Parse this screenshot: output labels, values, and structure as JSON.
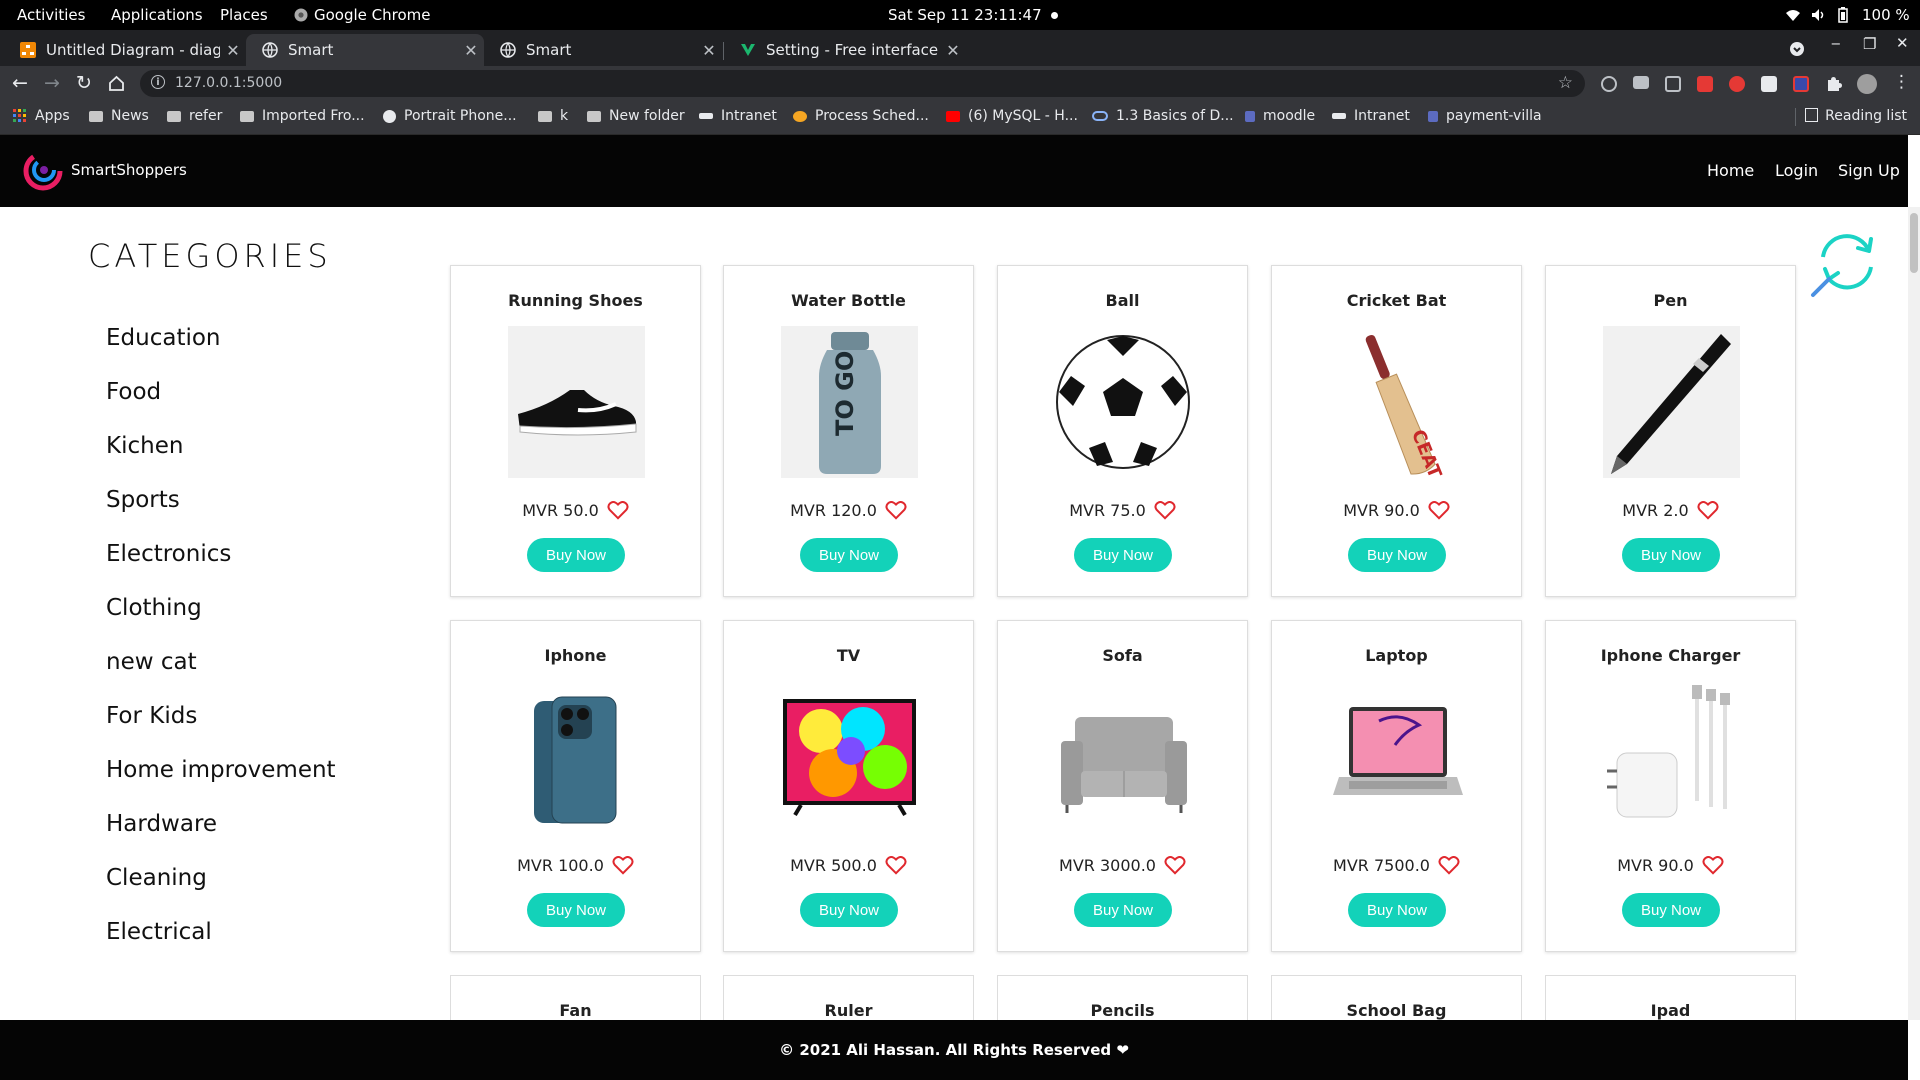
{
  "system_bar": {
    "activities": "Activities",
    "applications": "Applications",
    "places": "Places",
    "app_name": "Google Chrome",
    "clock": "Sat Sep 11  23:11:47",
    "battery": "100 %"
  },
  "browser": {
    "tabs": [
      {
        "title": "Untitled Diagram - diagrams.net"
      },
      {
        "title": "Smart"
      },
      {
        "title": "Smart"
      },
      {
        "title": "Setting - Free interface icons"
      }
    ],
    "url": "127.0.0.1:5000",
    "bookmarks": [
      {
        "label": "Apps",
        "icon": "apps-grid-icon"
      },
      {
        "label": "News",
        "icon": "folder-icon"
      },
      {
        "label": "refer",
        "icon": "folder-icon"
      },
      {
        "label": "Imported Fro...",
        "icon": "folder-icon"
      },
      {
        "label": "Portrait Phone...",
        "icon": "globe-icon"
      },
      {
        "label": "k",
        "icon": "folder-icon"
      },
      {
        "label": "New folder",
        "icon": "folder-icon"
      },
      {
        "label": "Intranet",
        "icon": "intranet-icon"
      },
      {
        "label": "Process Sched...",
        "icon": "process-icon"
      },
      {
        "label": "(6) MySQL - H...",
        "icon": "youtube-icon"
      },
      {
        "label": "1.3 Basics of D...",
        "icon": "link-icon"
      },
      {
        "label": "moodle",
        "icon": "moodle-icon"
      },
      {
        "label": "Intranet",
        "icon": "intranet-icon"
      },
      {
        "label": "payment-villa",
        "icon": "moodle-icon"
      }
    ],
    "reading_list": "Reading list"
  },
  "site": {
    "brand": "SmartShoppers",
    "nav": {
      "home": "Home",
      "login": "Login",
      "signup": "Sign Up"
    },
    "categories_title": "CATEGORIES",
    "categories": [
      "Education",
      "Food",
      "Kichen",
      "Sports",
      "Electronics",
      "Clothing",
      "new cat",
      "For Kids",
      "Home improvement",
      "Hardware",
      "Cleaning",
      "Electrical"
    ],
    "buy_label": "Buy Now",
    "products": [
      {
        "name": "Running Shoes",
        "price": "MVR 50.0",
        "icon": "shoe-image"
      },
      {
        "name": "Water Bottle",
        "price": "MVR 120.0",
        "icon": "bottle-image"
      },
      {
        "name": "Ball",
        "price": "MVR 75.0",
        "icon": "ball-image"
      },
      {
        "name": "Cricket Bat",
        "price": "MVR 90.0",
        "icon": "bat-image"
      },
      {
        "name": "Pen",
        "price": "MVR 2.0",
        "icon": "pen-image"
      },
      {
        "name": "Iphone",
        "price": "MVR 100.0",
        "icon": "phone-image"
      },
      {
        "name": "TV",
        "price": "MVR 500.0",
        "icon": "tv-image"
      },
      {
        "name": "Sofa",
        "price": "MVR 3000.0",
        "icon": "sofa-image"
      },
      {
        "name": "Laptop",
        "price": "MVR 7500.0",
        "icon": "laptop-image"
      },
      {
        "name": "Iphone Charger",
        "price": "MVR 90.0",
        "icon": "charger-image"
      }
    ],
    "partial_products": [
      "Fan",
      "Ruler",
      "Pencils",
      "School Bag",
      "Ipad"
    ],
    "footer": "© 2021 Ali Hassan. All Rights Reserved ❤",
    "colors": {
      "accent": "#13d2b9",
      "heart": "#e0282e",
      "header_bg": "#050505"
    }
  }
}
